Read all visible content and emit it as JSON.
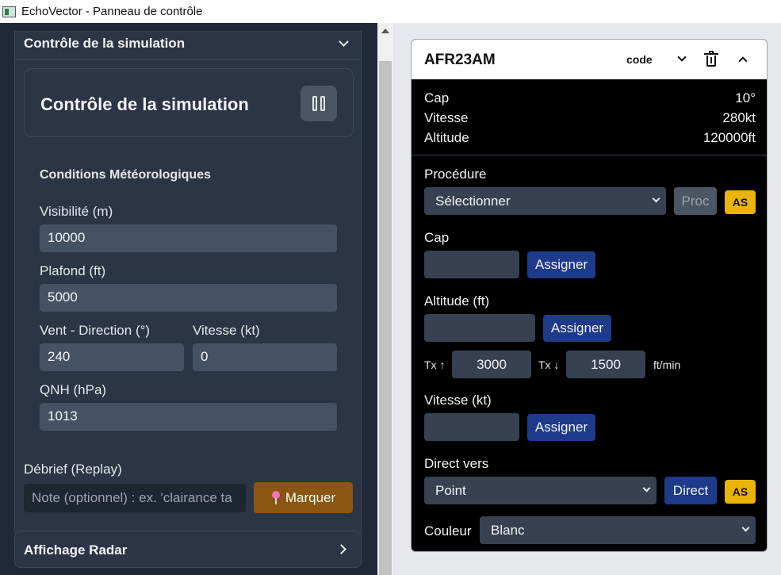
{
  "window": {
    "title": "EchoVector - Panneau de contrôle"
  },
  "left": {
    "section_title": "Contrôle de la simulation",
    "sim_title": "Contrôle de la simulation",
    "weather": {
      "heading": "Conditions Météorologiques",
      "visibility_label": "Visibilité (m)",
      "visibility_value": "10000",
      "ceiling_label": "Plafond (ft)",
      "ceiling_value": "5000",
      "wind_dir_label": "Vent - Direction (°)",
      "wind_dir_value": "240",
      "wind_speed_label": "Vitesse (kt)",
      "wind_speed_value": "0",
      "qnh_label": "QNH (hPa)",
      "qnh_value": "1013"
    },
    "debrief": {
      "label": "Débrief (Replay)",
      "note_placeholder": "Note (optionnel) : ex. 'clairance ta",
      "mark_label": "Marquer"
    },
    "radar_title": "Affichage Radar"
  },
  "strip": {
    "callsign": "AFR23AM",
    "code_label": "code",
    "info": [
      {
        "label": "Cap",
        "value": "10°"
      },
      {
        "label": "Vitesse",
        "value": "280kt"
      },
      {
        "label": "Altitude",
        "value": "120000ft"
      }
    ],
    "procedure": {
      "label": "Procédure",
      "selected": "Sélectionner",
      "proc_button": "Proc",
      "as_button": "AS"
    },
    "heading": {
      "label": "Cap",
      "assign_label": "Assigner"
    },
    "altitude": {
      "label": "Altitude (ft)",
      "assign_label": "Assigner",
      "climb_label": "Tx ↑",
      "climb_value": "3000",
      "descent_label": "Tx ↓",
      "descent_value": "1500",
      "unit": "ft/min"
    },
    "speed": {
      "label": "Vitesse (kt)",
      "assign_label": "Assigner"
    },
    "direct": {
      "label": "Direct vers",
      "selected": "Point",
      "direct_button": "Direct",
      "as_button": "AS"
    },
    "color": {
      "label": "Couleur",
      "selected": "Blanc"
    }
  },
  "colors": {
    "accent_blue": "#1e3a8a",
    "as_yellow": "#eab308",
    "mark_brown": "#8a5611"
  }
}
